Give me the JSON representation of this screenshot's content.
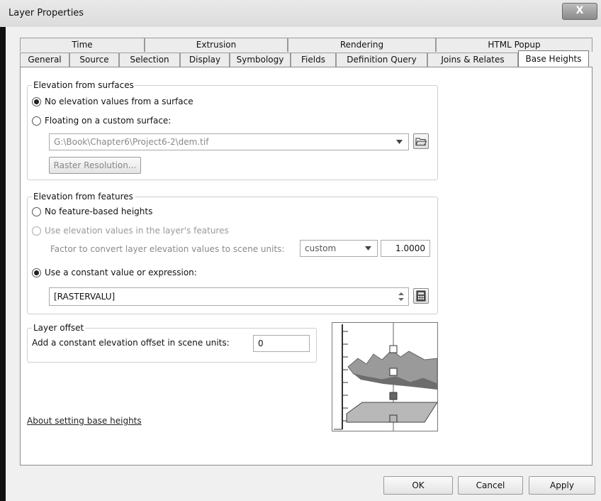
{
  "window": {
    "title": "Layer Properties",
    "close_label": "X"
  },
  "tabs_top": [
    "Time",
    "Extrusion",
    "Rendering",
    "HTML Popup"
  ],
  "tabs_bottom": [
    "General",
    "Source",
    "Selection",
    "Display",
    "Symbology",
    "Fields",
    "Definition Query",
    "Joins & Relates",
    "Base Heights"
  ],
  "active_tab": "Base Heights",
  "surfaces": {
    "legend": "Elevation from surfaces",
    "option_none": "No elevation values from a surface",
    "option_floating": "Floating on a custom surface:",
    "surface_path": "G:\\Book\\Chapter6\\Project6-2\\dem.tif",
    "raster_button": "Raster Resolution..."
  },
  "features": {
    "legend": "Elevation from features",
    "option_none": "No feature-based heights",
    "option_layer": "Use elevation values in the layer's features",
    "factor_label": "Factor to convert layer elevation values to scene units:",
    "factor_unit": "custom",
    "factor_value": "1.0000",
    "option_constant": "Use a constant value or expression:",
    "expression": "[RASTERVALU]"
  },
  "offset": {
    "legend": "Layer offset",
    "label": "Add a constant elevation offset in scene units:",
    "value": "0"
  },
  "about_link": "About setting base heights",
  "buttons": {
    "ok": "OK",
    "cancel": "Cancel",
    "apply": "Apply"
  },
  "icons": [
    "folder-open-icon",
    "calculator-icon",
    "chevron-down-icon",
    "spin-arrows-icon"
  ]
}
